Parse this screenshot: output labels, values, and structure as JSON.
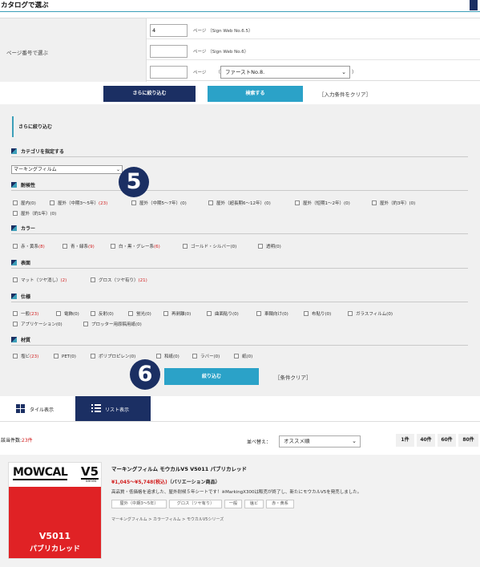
{
  "header": {
    "title": "カタログで選ぶ"
  },
  "page_select": {
    "label": "ページ番号で選ぶ",
    "rows": [
      {
        "value": "4",
        "suffix": "ページ （Sign Web No.6.5）"
      },
      {
        "value": "",
        "suffix": "ページ （Sign Web No.6）"
      },
      {
        "value": "",
        "suffix": "ページ",
        "open_paren": "（",
        "catalog": "ファーストNo.8.",
        "close_paren": "）"
      }
    ],
    "narrow_button": "さらに絞り込む",
    "search_button": "検索する",
    "clear_link": "［入力条件をクリア］"
  },
  "filter": {
    "title": "さらに絞り込む",
    "category": {
      "heading": "カテゴリを指定する",
      "selected": "マーキングフィルム"
    },
    "sections": {
      "durability": {
        "heading": "耐候性",
        "items": [
          {
            "label": "屋内(0)"
          },
          {
            "label": "屋外（中期3〜5年）",
            "count": "(23)"
          },
          {
            "label": "屋外（中期5〜7年）(0)"
          },
          {
            "label": "屋外（超長期6〜12年）(0)"
          },
          {
            "label": "屋外（短期1〜2年）(0)"
          },
          {
            "label": "屋外（約3年）(0)"
          },
          {
            "label": "屋外（約1年）(0)"
          }
        ]
      },
      "color": {
        "heading": "カラー",
        "items": [
          {
            "label": "赤・黄系",
            "count": "(8)"
          },
          {
            "label": "青・緑系",
            "count": "(9)"
          },
          {
            "label": "白・黒・グレー系",
            "count": "(6)"
          },
          {
            "label": "ゴールド・シルバー(0)"
          },
          {
            "label": "透明(0)"
          }
        ]
      },
      "surface": {
        "heading": "表面",
        "items": [
          {
            "label": "マット（ツヤ消し）",
            "count": "(2)"
          },
          {
            "label": "グロス（ツヤ有り）",
            "count": "(21)"
          }
        ]
      },
      "spec": {
        "heading": "仕様",
        "items": [
          {
            "label": "一般",
            "count": "(23)"
          },
          {
            "label": "電飾(0)"
          },
          {
            "label": "反射(0)"
          },
          {
            "label": "蛍光(0)"
          },
          {
            "label": "再剥離(0)"
          },
          {
            "label": "曲面貼り(0)"
          },
          {
            "label": "車輌向け(0)"
          },
          {
            "label": "布貼り(0)"
          },
          {
            "label": "ガラスフィルム(0)"
          },
          {
            "label": "アプリケーション(0)"
          },
          {
            "label": "プロッター用原稿用紙(0)"
          }
        ]
      },
      "material": {
        "heading": "材質",
        "items": [
          {
            "label": "塩ビ",
            "count": "(23)"
          },
          {
            "label": "PET(0)"
          },
          {
            "label": "ポリプロピレン(0)"
          },
          {
            "label": "和紙(0)"
          },
          {
            "label": "ラバー(0)"
          },
          {
            "label": "紙(0)"
          }
        ]
      }
    },
    "apply_button": "絞り込む",
    "clear_link": "［条件クリア］",
    "badges": [
      "5",
      "6"
    ]
  },
  "tabs": {
    "tile": "タイル表示",
    "list": "リスト表示"
  },
  "results": {
    "count_label": "該当件数:",
    "count": "23件",
    "sort_label": "並べ替え：",
    "sort_value": "オススメ順",
    "per_page": [
      "1件",
      "40件",
      "60件",
      "80件"
    ]
  },
  "product": {
    "image": {
      "brand": "MOWCAL",
      "series_name": "V5",
      "series_word": "series",
      "code": "V5011",
      "name": "パブリカレッド"
    },
    "title": "マーキングフィルム モウカルV5 V5011 パブリカレッド",
    "price": "¥1,045〜¥5,748(税込)",
    "variation": "（バリエーション商品）",
    "description": "高品質・低価格を追求した、屋外耐候５年シートです！※MarkingX300は販売が終了し、新たにモウカルV5を発売しました。",
    "tags": [
      "屋外（中期3〜5年）",
      "グロス（ツヤ有り）",
      "一般",
      "塩ビ",
      "赤・黄系"
    ],
    "breadcrumb": "マーキングフィルム > カラーフィルム > モウカルV5シリーズ"
  },
  "colors": {
    "navy": "#1b2f63",
    "teal": "#2ba2c8",
    "red": "#d21f1f",
    "panel": "#f0f0f0"
  }
}
